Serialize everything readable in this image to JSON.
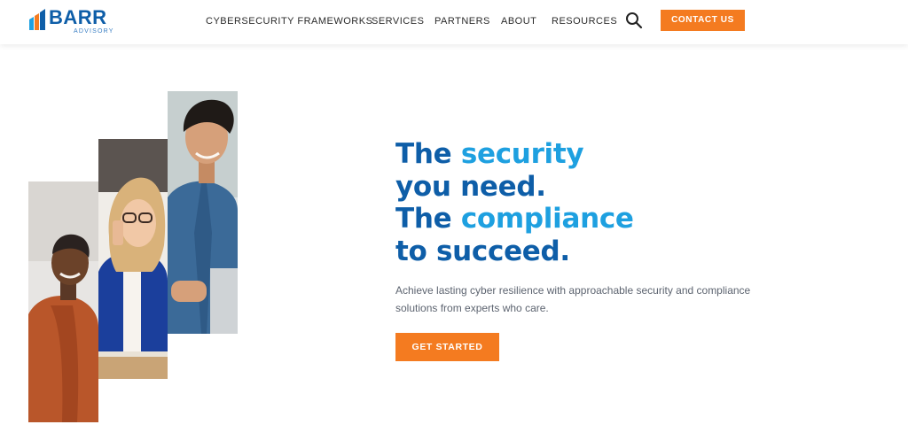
{
  "brand": {
    "name": "BARR",
    "tagline": "ADVISORY"
  },
  "nav": {
    "items": [
      {
        "label": "CYBERSECURITY FRAMEWORKS"
      },
      {
        "label": "SERVICES"
      },
      {
        "label": "PARTNERS"
      },
      {
        "label": "ABOUT"
      },
      {
        "label": "RESOURCES"
      }
    ],
    "contact_label": "CONTACT US"
  },
  "hero": {
    "line1_a": "The ",
    "line1_b": "security",
    "line2": "you need.",
    "line3_a": "The ",
    "line3_b": "compliance",
    "line4": "to succeed.",
    "subtext": "Achieve lasting cyber resilience with approachable security and compliance solutions from experts who care.",
    "cta_label": "GET STARTED"
  },
  "colors": {
    "brand_blue": "#0e5ea8",
    "accent_blue": "#1ea0e0",
    "accent_orange": "#f47b20"
  }
}
